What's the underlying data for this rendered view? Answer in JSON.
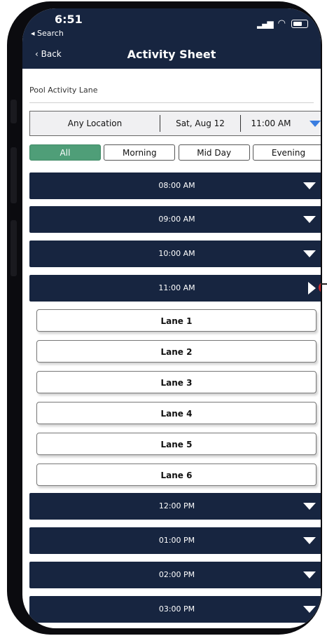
{
  "status_bar": {
    "time": "6:51",
    "back_app": "◂ Search"
  },
  "nav": {
    "back_label": "‹ Back",
    "title": "Activity Sheet"
  },
  "subtitle": "Pool Activity Lane",
  "filter": {
    "location": "Any Location",
    "date": "Sat, Aug 12",
    "time": "11:00 AM"
  },
  "tabs": [
    {
      "label": "All",
      "active": true
    },
    {
      "label": "Morning",
      "active": false
    },
    {
      "label": "Mid Day",
      "active": false
    },
    {
      "label": "Evening",
      "active": false
    }
  ],
  "slots_before": [
    "08:00 AM",
    "09:00 AM",
    "10:00 AM"
  ],
  "expanded_slot": {
    "label": "11:00 AM"
  },
  "lanes": [
    "Lane 1",
    "Lane 2",
    "Lane 3",
    "Lane 4",
    "Lane 5",
    "Lane 6"
  ],
  "slots_after": [
    "12:00 PM",
    "01:00 PM",
    "02:00 PM",
    "03:00 PM"
  ],
  "colors": {
    "header": "#172540",
    "accent_green": "#4f9e78",
    "dropdown_blue": "#3a7de0",
    "marker_red": "#c8262a"
  }
}
